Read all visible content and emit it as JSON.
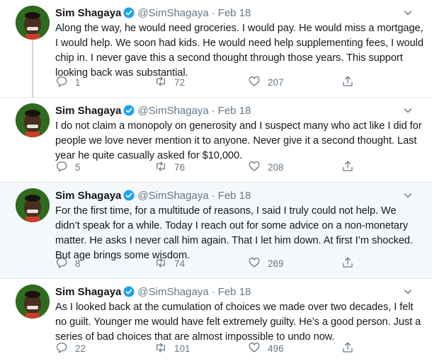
{
  "tweets": [
    {
      "name": "Sim Shagaya",
      "handle": "@SimShagaya",
      "separator": "·",
      "date": "Feb 18",
      "text": "Along the way, he would need groceries. I would pay. He would miss a mortgage, I would help. We soon had kids. He would need help supplementing fees, I would chip in. I never gave this a second thought through those years. This support looking back was substantial.",
      "replies": "1",
      "retweets": "72",
      "likes": "207"
    },
    {
      "name": "Sim Shagaya",
      "handle": "@SimShagaya",
      "separator": "·",
      "date": "Feb 18",
      "text": "I do not claim a monopoly on generosity and I suspect many who act like I did for people we love never mention it to anyone. Never give it a second thought. Last year he quite casually asked for $10,000.",
      "replies": "5",
      "retweets": "76",
      "likes": "208"
    },
    {
      "name": "Sim Shagaya",
      "handle": "@SimShagaya",
      "separator": "·",
      "date": "Feb 18",
      "text": "For the first time, for a multitude of reasons, I said I truly could not help. We didn’t speak for a while. Today I reach out for some advice on a non-monetary matter. He asks I never call him again. That I let him down. At first I’m shocked. But age brings some wisdom.",
      "replies": "8",
      "retweets": "74",
      "likes": "269"
    },
    {
      "name": "Sim Shagaya",
      "handle": "@SimShagaya",
      "separator": "·",
      "date": "Feb 18",
      "text": "As I looked back at the cumulation of choices we made over two decades, I felt no guilt. Younger me would have felt extremely guilty. He’s a good person. Just a series of bad choices that are almost impossible to undo now.",
      "replies": "22",
      "retweets": "101",
      "likes": "496"
    }
  ],
  "icons": {
    "verified": "verified-badge-icon",
    "caret": "chevron-down-icon",
    "reply": "reply-icon",
    "retweet": "retweet-icon",
    "like": "heart-icon",
    "share": "share-icon"
  },
  "colors": {
    "text": "#14171a",
    "secondary": "#657786",
    "verified": "#1da1f2",
    "highlight_background": "#f5f8fa",
    "thread_line": "#ccd6dd"
  }
}
